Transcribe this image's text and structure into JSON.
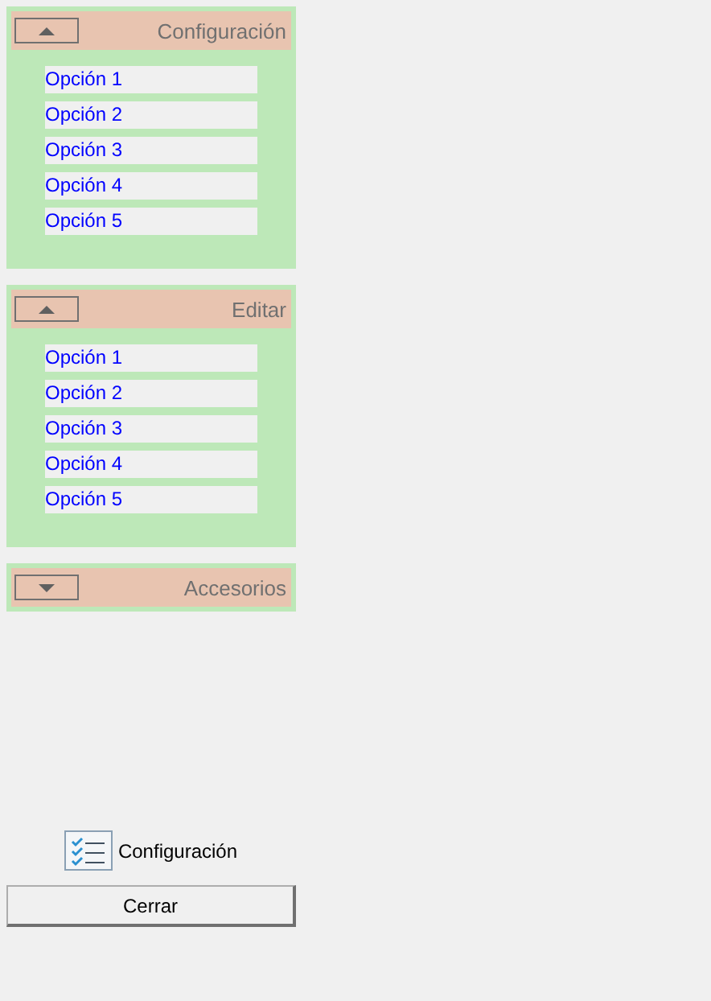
{
  "panels": [
    {
      "title": "Configuración",
      "expanded": true,
      "items": [
        "Opción 1",
        "Opción 2",
        "Opción 3",
        "Opción 4",
        "Opción 5"
      ]
    },
    {
      "title": "Editar",
      "expanded": true,
      "items": [
        "Opción 1",
        "Opción 2",
        "Opción 3",
        "Opción 4",
        "Opción 5"
      ]
    },
    {
      "title": "Accesorios",
      "expanded": false
    }
  ],
  "footer": {
    "label": "Configuración",
    "button": "Cerrar"
  }
}
